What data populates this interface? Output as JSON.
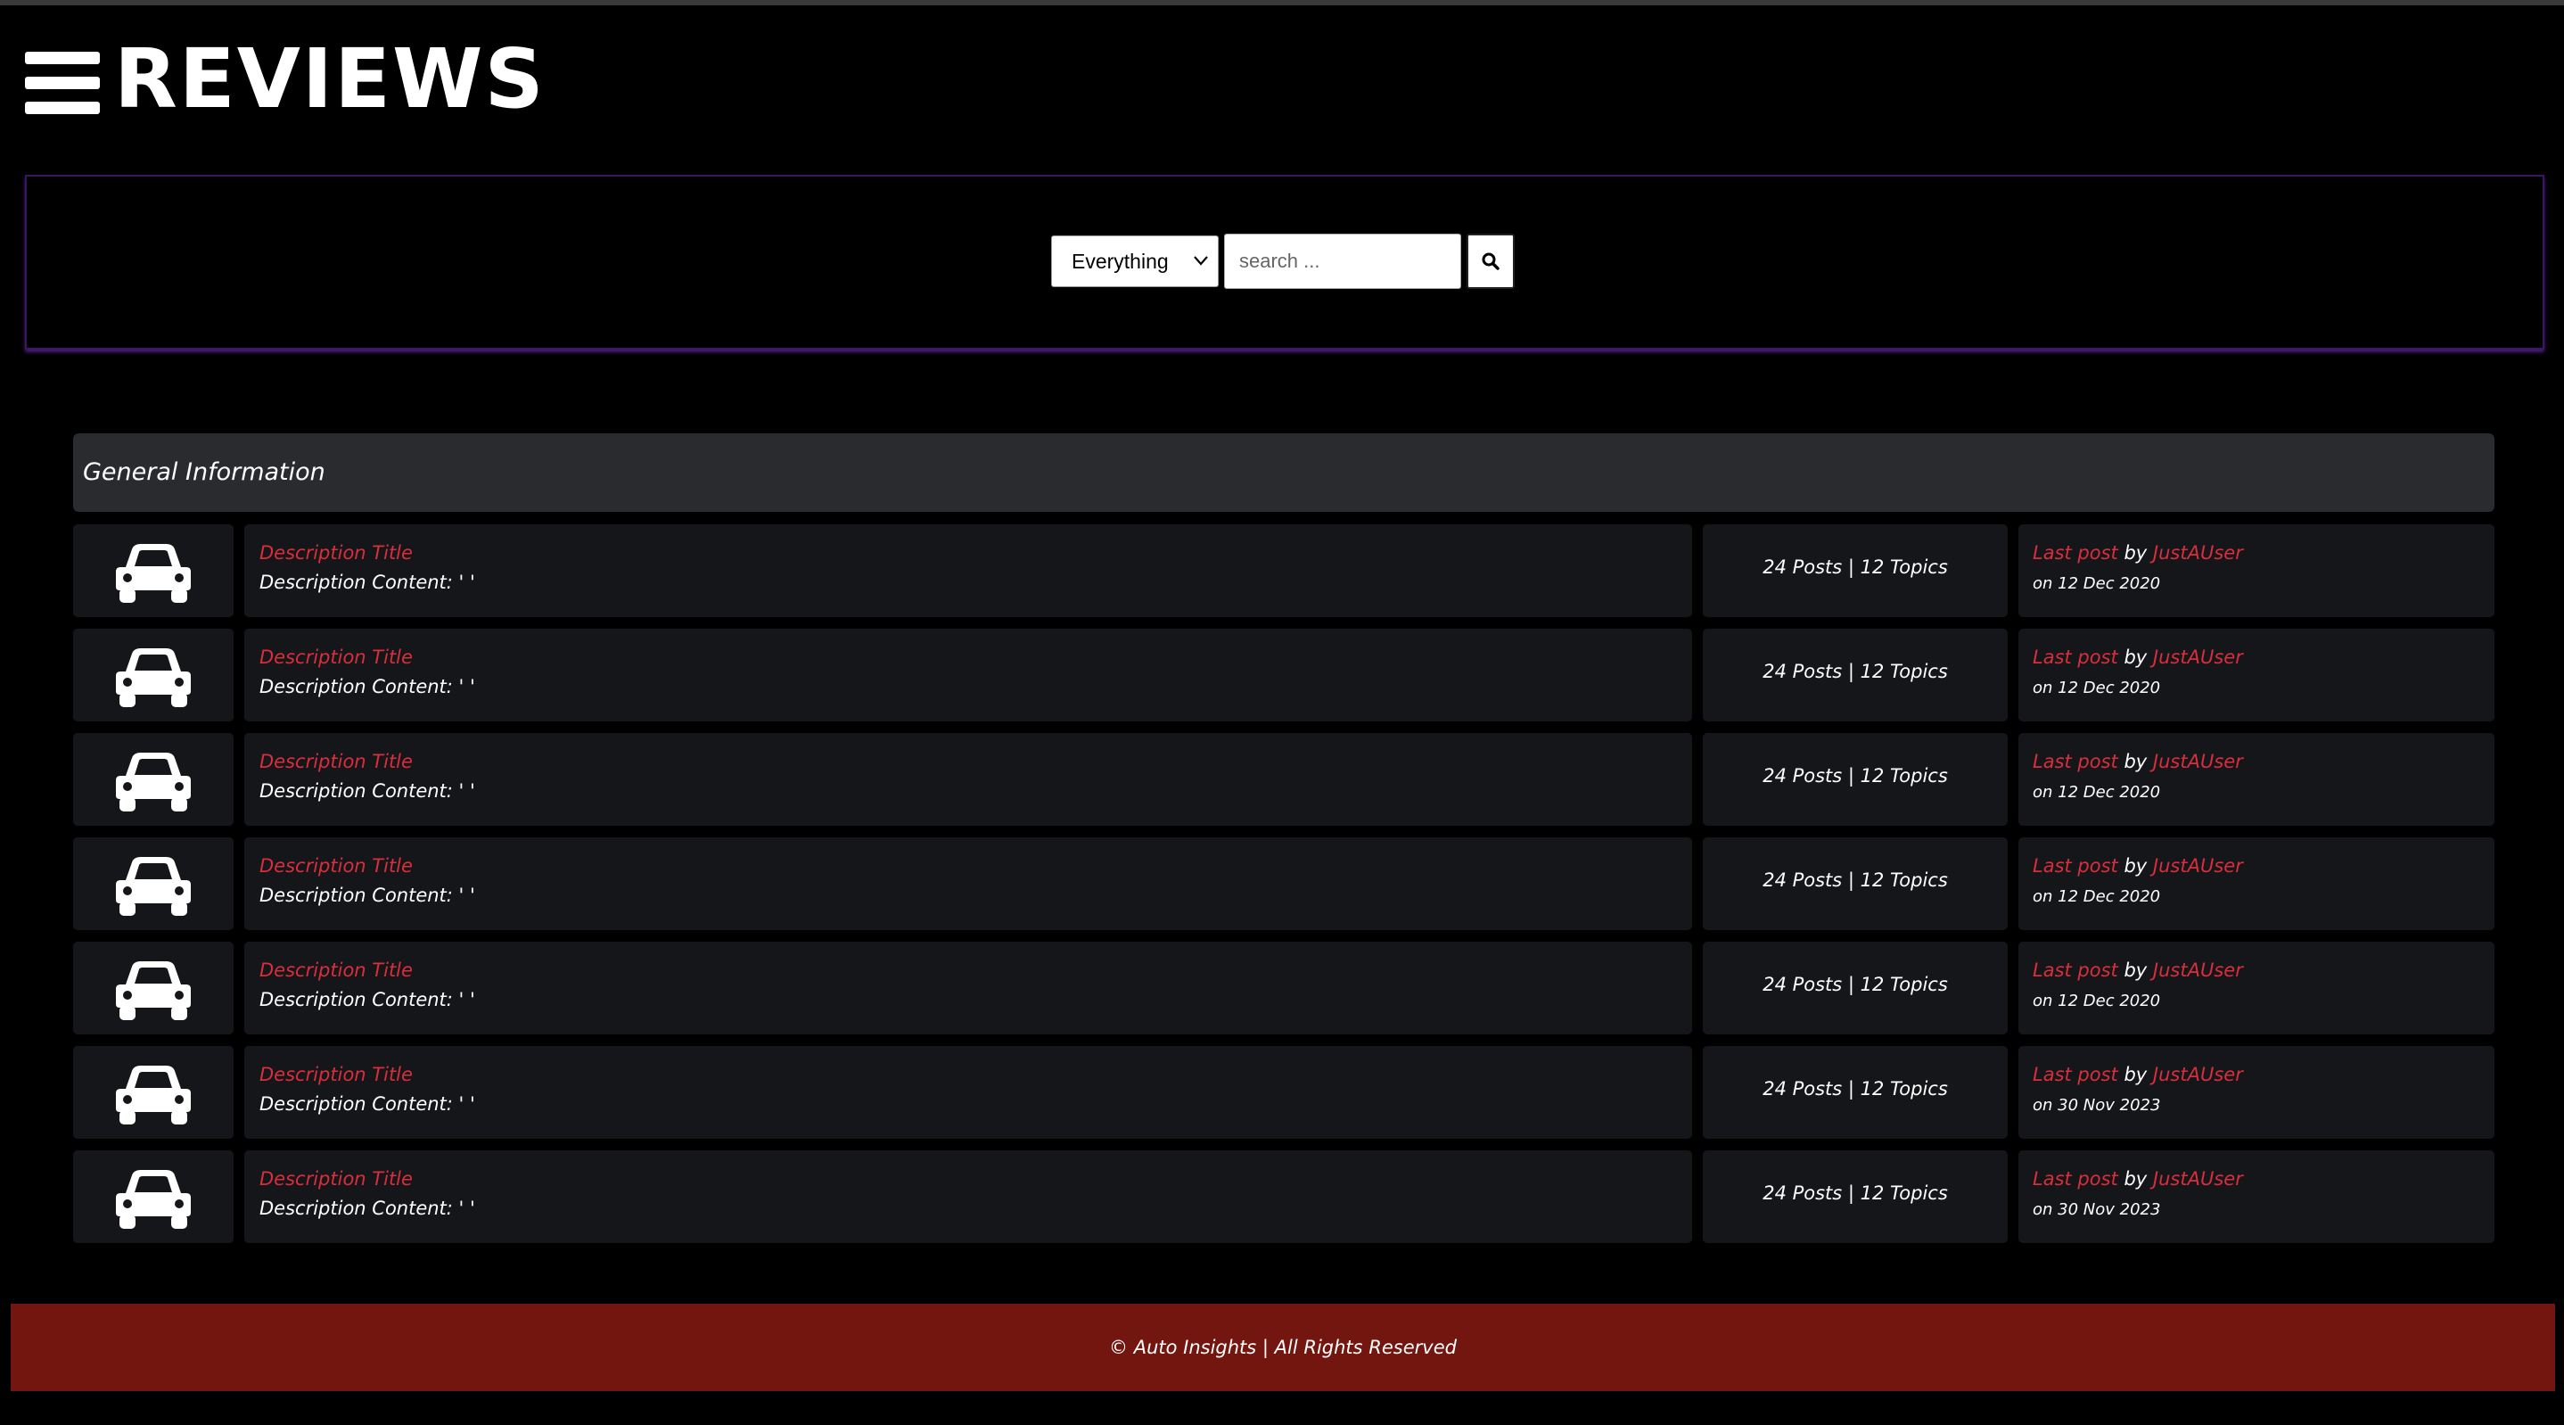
{
  "header": {
    "title": "REVIEWS",
    "menu_icon": "hamburger-menu-icon"
  },
  "search": {
    "scope_selected": "Everything",
    "placeholder": "search ...",
    "value": "",
    "button_icon": "magnifier-icon"
  },
  "section": {
    "title": "General Information"
  },
  "rows": [
    {
      "icon": "car-icon",
      "title": "Description Title",
      "content": "Description Content: ' '",
      "stats": "24 Posts | 12 Topics",
      "last_post_label": "Last post",
      "by_label": "by",
      "user": "JustAUser",
      "date": "on 12 Dec 2020"
    },
    {
      "icon": "car-icon",
      "title": "Description Title",
      "content": "Description Content: ' '",
      "stats": "24 Posts | 12 Topics",
      "last_post_label": "Last post",
      "by_label": "by",
      "user": "JustAUser",
      "date": "on 12 Dec 2020"
    },
    {
      "icon": "car-icon",
      "title": "Description Title",
      "content": "Description Content: ' '",
      "stats": "24 Posts | 12 Topics",
      "last_post_label": "Last post",
      "by_label": "by",
      "user": "JustAUser",
      "date": "on 12 Dec 2020"
    },
    {
      "icon": "car-icon",
      "title": "Description Title",
      "content": "Description Content: ' '",
      "stats": "24 Posts | 12 Topics",
      "last_post_label": "Last post",
      "by_label": "by",
      "user": "JustAUser",
      "date": "on 12 Dec 2020"
    },
    {
      "icon": "car-icon",
      "title": "Description Title",
      "content": "Description Content: ' '",
      "stats": "24 Posts | 12 Topics",
      "last_post_label": "Last post",
      "by_label": "by",
      "user": "JustAUser",
      "date": "on 12 Dec 2020"
    },
    {
      "icon": "car-icon",
      "title": "Description Title",
      "content": "Description Content: ' '",
      "stats": "24 Posts | 12 Topics",
      "last_post_label": "Last post",
      "by_label": "by",
      "user": "JustAUser",
      "date": "on 30 Nov 2023"
    },
    {
      "icon": "car-icon",
      "title": "Description Title",
      "content": "Description Content: ' '",
      "stats": "24 Posts | 12 Topics",
      "last_post_label": "Last post",
      "by_label": "by",
      "user": "JustAUser",
      "date": "on 30 Nov 2023"
    }
  ],
  "footer": {
    "text": "© Auto Insights | All Rights Reserved"
  },
  "colors": {
    "background": "#000000",
    "accent_red": "#d92e3c",
    "footer_bg": "#731610",
    "panel_border": "#3b1760",
    "section_header_bg": "#2a2b2f",
    "row_bg": "#15161a"
  }
}
